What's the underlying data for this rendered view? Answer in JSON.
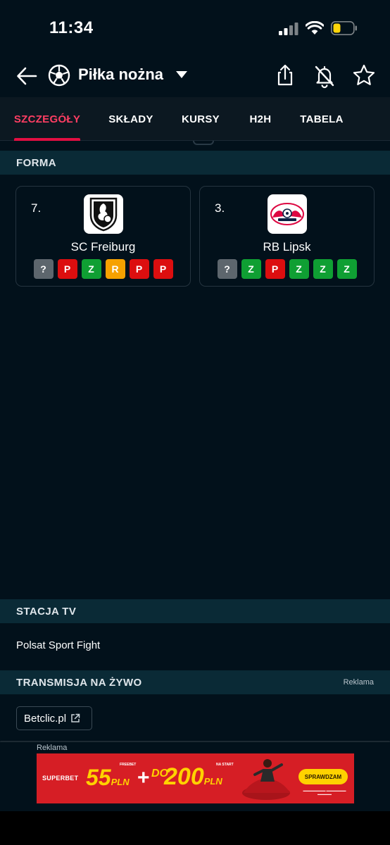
{
  "status_bar": {
    "time": "11:34"
  },
  "header": {
    "title": "Piłka nożna",
    "sport_icon": "soccer-ball-icon"
  },
  "tabs": [
    {
      "label": "SZCZEGÓŁY",
      "active": true
    },
    {
      "label": "SKŁADY",
      "active": false
    },
    {
      "label": "KURSY",
      "active": false
    },
    {
      "label": "H2H",
      "active": false
    },
    {
      "label": "TABELA",
      "active": false
    }
  ],
  "form": {
    "title": "FORMA",
    "teams": [
      {
        "rank": "7.",
        "name": "SC Freiburg",
        "results": [
          "?",
          "P",
          "Z",
          "R",
          "P",
          "P"
        ]
      },
      {
        "rank": "3.",
        "name": "RB Lipsk",
        "results": [
          "?",
          "Z",
          "P",
          "Z",
          "Z",
          "Z"
        ]
      }
    ]
  },
  "result_colors": {
    "?": "#5d666d",
    "P": "#dc0e0f",
    "Z": "#0f9f33",
    "R": "#f6a100"
  },
  "tv": {
    "title": "STACJA TV",
    "station": "Polsat Sport Fight"
  },
  "live": {
    "title": "TRANSMISJA NA ŻYWO",
    "ad_tag": "Reklama",
    "link": "Betclic.pl"
  },
  "ad": {
    "label": "Reklama",
    "brand": "SUPERBET",
    "amount1": "55",
    "currency1": "PLN",
    "tiny1": "FREEBET",
    "plus": "+",
    "prefix2": "DO",
    "amount2": "200",
    "currency2": "PLN",
    "tiny2": "NA START",
    "cta": "SPRAWDZAM",
    "brand_color": "#d61e25"
  },
  "colors": {
    "accent": "#e20f42",
    "background": "#02111b",
    "section": "#0a2a36"
  }
}
